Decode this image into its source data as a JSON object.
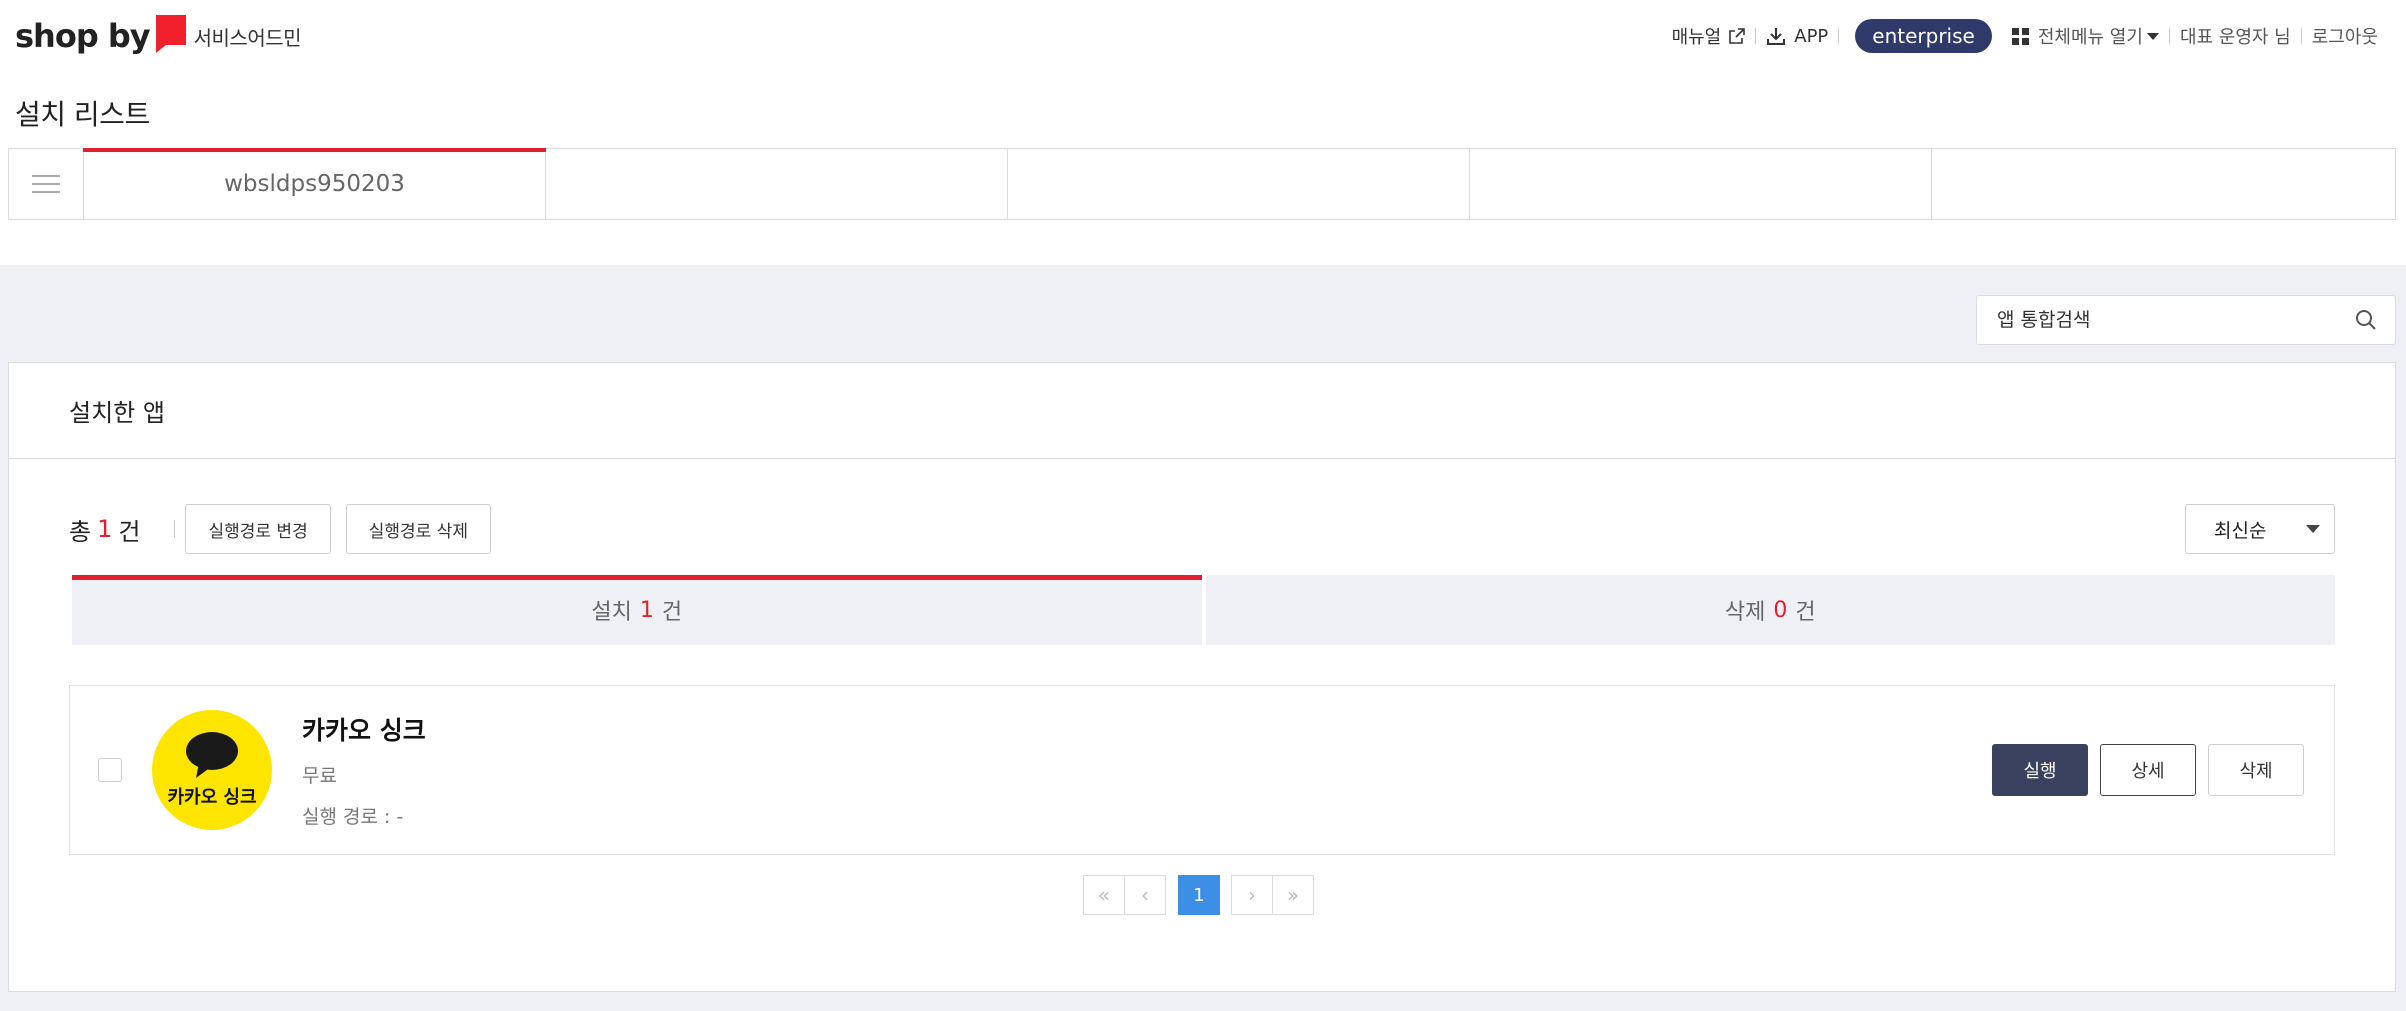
{
  "header": {
    "logo_text": "shop by",
    "service_label": "서비스어드민",
    "manual_label": "매뉴얼",
    "app_label": "APP",
    "plan_badge": "enterprise",
    "all_menu_label": "전체메뉴 열기",
    "user_label": "대표 운영자 님",
    "logout_label": "로그아웃"
  },
  "page": {
    "title": "설치 리스트"
  },
  "top_tabs": [
    {
      "label": "wbsldps950203",
      "active": true
    },
    {
      "label": ""
    },
    {
      "label": ""
    },
    {
      "label": ""
    },
    {
      "label": ""
    }
  ],
  "search": {
    "placeholder": "앱 통합검색"
  },
  "section": {
    "title": "설치한 앱"
  },
  "toolbar": {
    "total_prefix": "총",
    "total_count": "1",
    "total_suffix": "건",
    "change_path_label": "실행경로 변경",
    "delete_path_label": "실행경로 삭제",
    "sort_value": "최신순"
  },
  "sub_tabs": [
    {
      "label": "설치",
      "count": "1",
      "suffix": "건",
      "active": true
    },
    {
      "label": "삭제",
      "count": "0",
      "suffix": "건",
      "active": false
    }
  ],
  "apps": [
    {
      "name": "카카오 싱크",
      "logo_text": "카카오 싱크",
      "price": "무료",
      "path": "실행 경로 : -",
      "run_label": "실행",
      "detail_label": "상세",
      "delete_label": "삭제"
    }
  ],
  "pagination": {
    "first": "«",
    "prev": "‹",
    "current": "1",
    "next": "›",
    "last": "»"
  },
  "colors": {
    "accent_red": "#e0202f",
    "badge_navy": "#2f3a6b",
    "run_button": "#3a4260",
    "page_active": "#3d8fe6",
    "kakao_yellow": "#fee500"
  }
}
